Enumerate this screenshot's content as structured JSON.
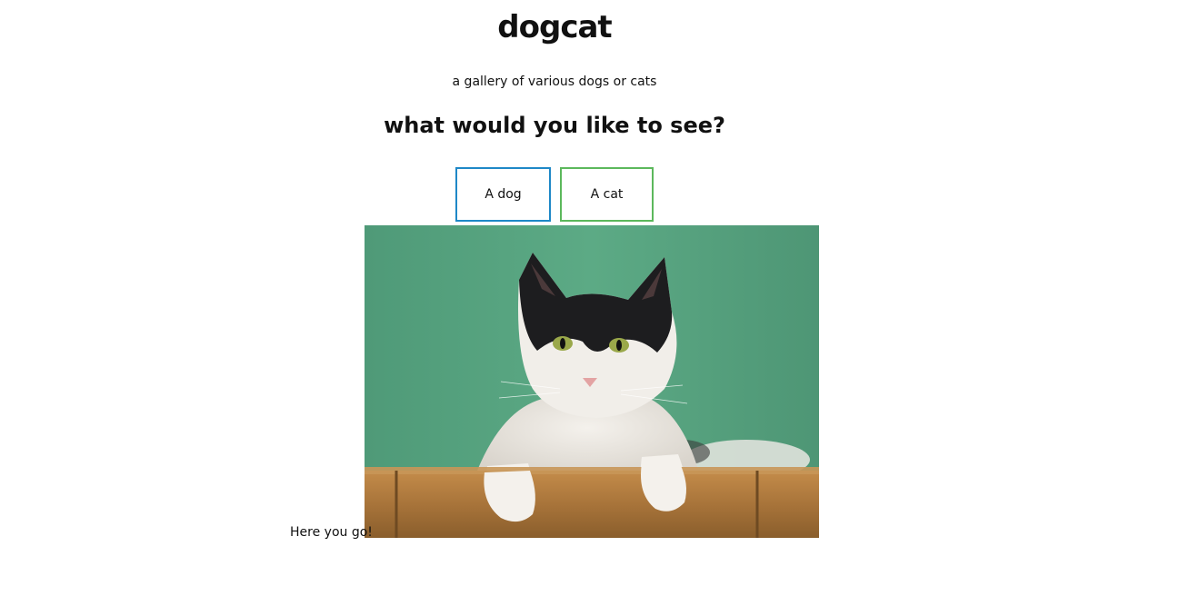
{
  "header": {
    "title": "dogcat",
    "tagline": "a gallery of various dogs or cats"
  },
  "main": {
    "question": "what would you like to see?",
    "buttons": [
      {
        "label": "A dog",
        "border_color": "#1e88c7"
      },
      {
        "label": "A cat",
        "border_color": "#5cb85c"
      }
    ],
    "result_text": "Here you go!",
    "image_alt": "cat photo"
  },
  "colors": {
    "background": "#ffffff",
    "text": "#111111",
    "photo_wall": "#5aa37f",
    "photo_bamboo": "#b07a3e"
  }
}
